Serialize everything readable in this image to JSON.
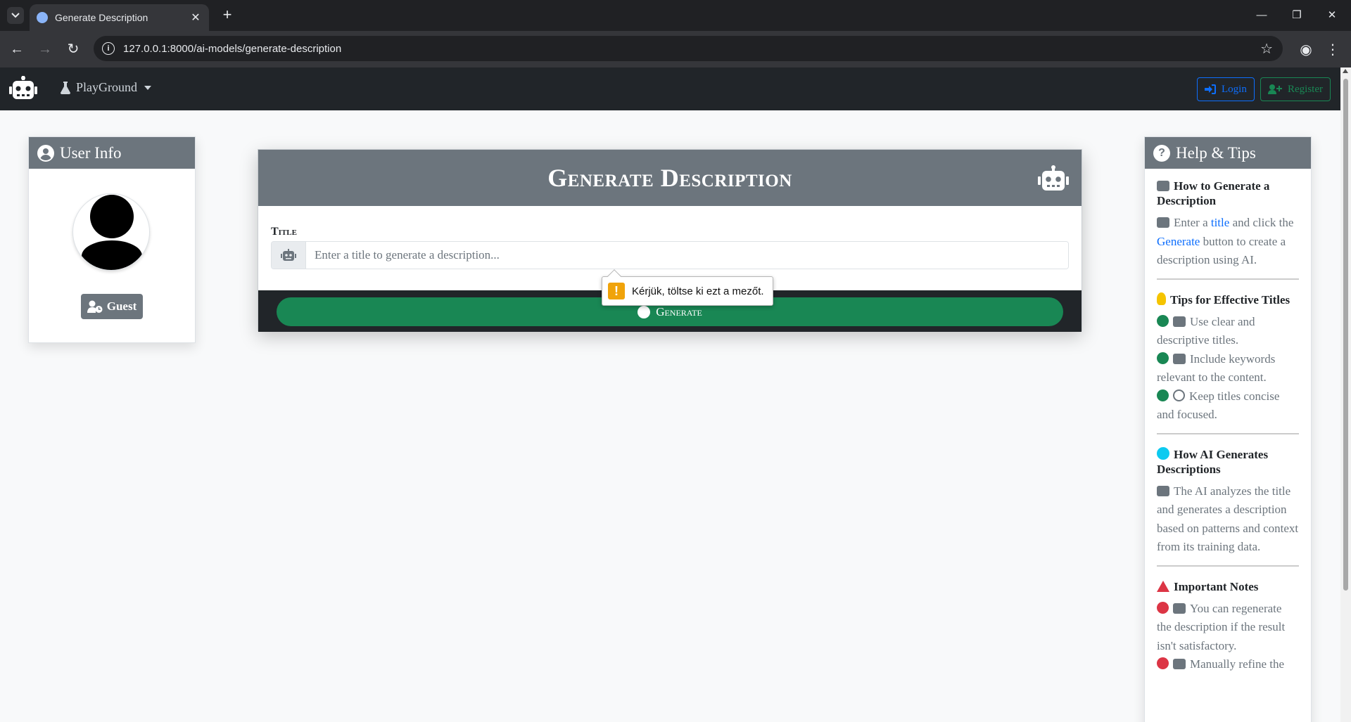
{
  "browser": {
    "tab_title": "Generate Description",
    "tab_close": "✕",
    "new_tab": "+",
    "url": "127.0.0.1:8000/ai-models/generate-description",
    "window_controls": [
      "—",
      "❐",
      "✕"
    ]
  },
  "navbar": {
    "brand_icon": "robot-icon",
    "menu_label": "PlayGround",
    "login_label": "Login",
    "register_label": "Register"
  },
  "user_card": {
    "title": "User Info",
    "badge": "Guest"
  },
  "generator": {
    "title": "Generate Description",
    "field_label": "Title",
    "input_value": "",
    "input_placeholder": "Enter a title to generate a description...",
    "button_label": "Generate",
    "validation_message": "Kérjük, töltse ki ezt a mezőt."
  },
  "help": {
    "title": "Help & Tips",
    "sections": [
      {
        "title": "How to Generate a Description",
        "text_prefix": "Enter a ",
        "link1": "title",
        "text_mid": " and click the ",
        "link2": "Generate",
        "text_suffix": " button to create a description using AI."
      },
      {
        "title": "Tips for Effective Titles",
        "items": [
          "Use clear and descriptive titles.",
          "Include keywords relevant to the content.",
          "Keep titles concise and focused."
        ]
      },
      {
        "title": "How AI Generates Descriptions",
        "text": "The AI analyzes the title and generates a description based on patterns and context from its training data."
      },
      {
        "title": "Important Notes",
        "items": [
          "You can regenerate the description if the result isn't satisfactory.",
          "Manually refine the"
        ]
      }
    ]
  },
  "colors": {
    "navbar": "#212529",
    "header_gray": "#6c757d",
    "primary": "#0d6efd",
    "success": "#198754",
    "danger": "#dc3545",
    "warning": "#f0a30a"
  }
}
